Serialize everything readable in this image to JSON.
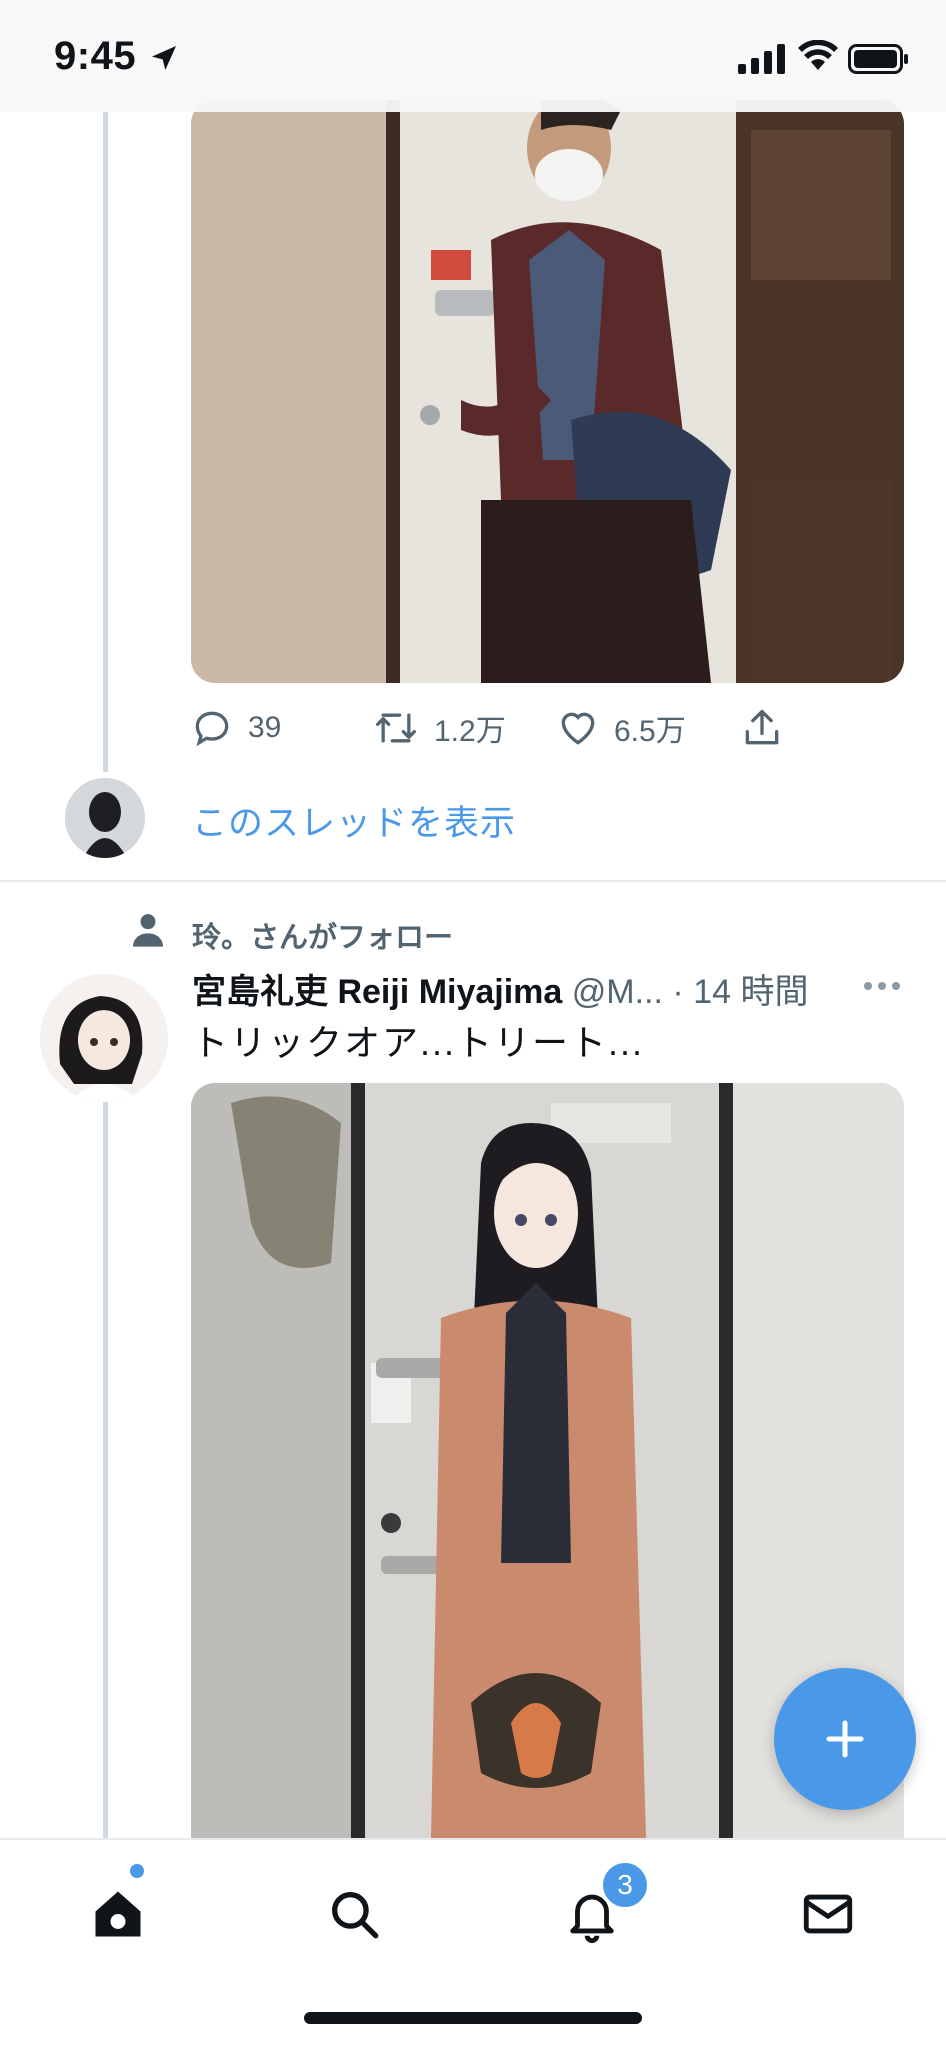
{
  "status_bar": {
    "time": "9:45"
  },
  "tweet1": {
    "reply_count": "39",
    "retweet_count": "1.2万",
    "like_count": "6.5万",
    "show_thread_label": "このスレッドを表示"
  },
  "tweet2": {
    "social_context": "玲。さんがフォロー",
    "author_name": "宮島礼吏 Reiji Miyajima",
    "author_handle": "@M...",
    "separator": "·",
    "time": "14 時間",
    "text": "トリックオア...トリート..."
  },
  "tab_bar": {
    "notification_badge": "3"
  },
  "colors": {
    "accent": "#4a99e9",
    "text_secondary": "#536471",
    "divider": "#e7eaec"
  }
}
